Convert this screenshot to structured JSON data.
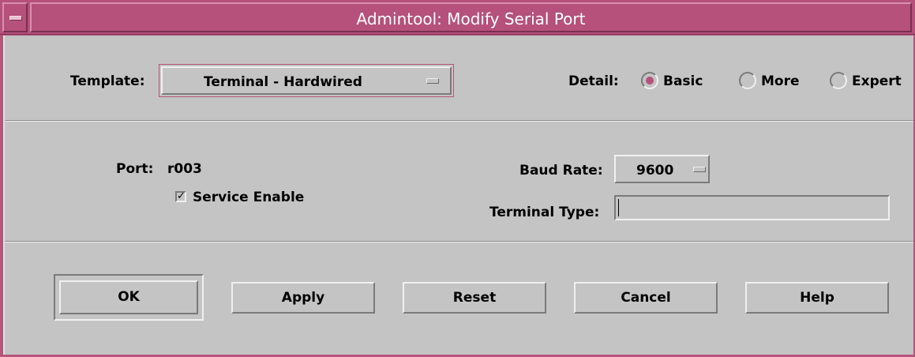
{
  "window": {
    "title": "Admintool: Modify Serial Port"
  },
  "template": {
    "label": "Template:",
    "value": "Terminal - Hardwired"
  },
  "detail": {
    "label": "Detail:",
    "options": [
      {
        "label": "Basic",
        "selected": true
      },
      {
        "label": "More",
        "selected": false
      },
      {
        "label": "Expert",
        "selected": false
      }
    ]
  },
  "port": {
    "label": "Port:",
    "value": "r003"
  },
  "service": {
    "label": "Service Enable",
    "checked": true
  },
  "baud": {
    "label": "Baud Rate:",
    "value": "9600"
  },
  "terminal_type": {
    "label": "Terminal Type:",
    "value": ""
  },
  "buttons": {
    "ok": "OK",
    "apply": "Apply",
    "reset": "Reset",
    "cancel": "Cancel",
    "help": "Help"
  },
  "colors": {
    "title_bar": "#b5517b",
    "background": "#c4c4c4",
    "radio_selected": "#b5517b"
  }
}
